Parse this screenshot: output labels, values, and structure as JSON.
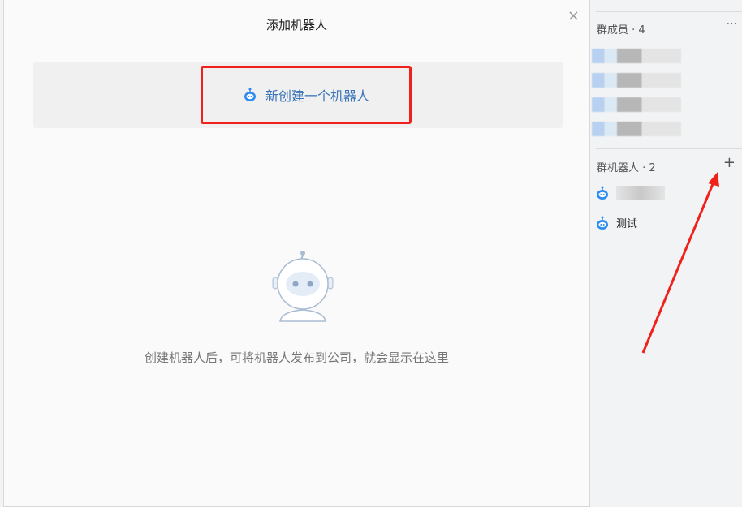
{
  "dialog": {
    "title": "添加机器人",
    "close": "×",
    "new_robot": "新创建一个机器人",
    "empty_text": "创建机器人后，可将机器人发布到公司，就会显示在这里"
  },
  "sidebar": {
    "members_label": "群成员 · 4",
    "more": "···",
    "robots_label": "群机器人 · 2",
    "add": "+",
    "robots": [
      {
        "name": ""
      },
      {
        "name": "测试"
      }
    ]
  },
  "colors": {
    "accent": "#2d8cf0",
    "highlight": "#f0201a"
  }
}
